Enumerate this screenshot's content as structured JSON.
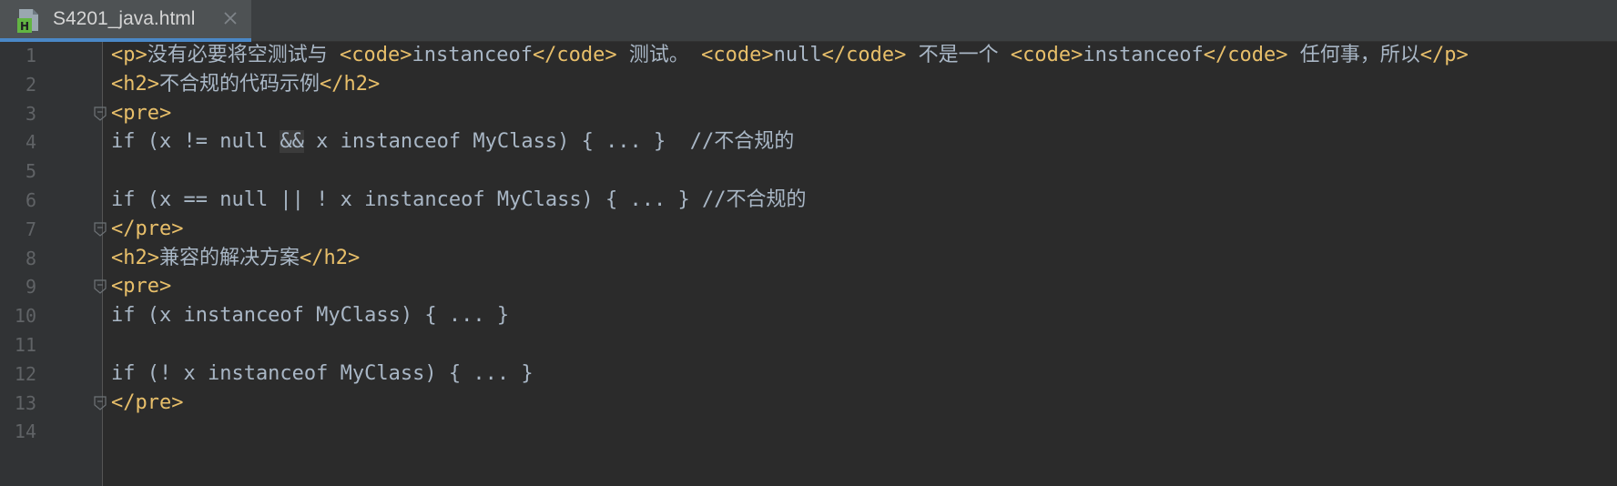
{
  "tab": {
    "label": "S4201_java.html",
    "icon": "html-file-icon"
  },
  "lines": [
    {
      "num": "1",
      "fold": false,
      "segments": [
        {
          "t": "tag",
          "v": "<p>"
        },
        {
          "t": "txt",
          "v": "没有必要将空测试与 "
        },
        {
          "t": "tag",
          "v": "<code>"
        },
        {
          "t": "txt",
          "v": "instanceof"
        },
        {
          "t": "tag",
          "v": "</code>"
        },
        {
          "t": "txt",
          "v": " 测试。 "
        },
        {
          "t": "tag",
          "v": "<code>"
        },
        {
          "t": "txt",
          "v": "null"
        },
        {
          "t": "tag",
          "v": "</code>"
        },
        {
          "t": "txt",
          "v": " 不是一个 "
        },
        {
          "t": "tag",
          "v": "<code>"
        },
        {
          "t": "txt",
          "v": "instanceof"
        },
        {
          "t": "tag",
          "v": "</code>"
        },
        {
          "t": "txt",
          "v": " 任何事，所以"
        },
        {
          "t": "tag",
          "v": "</p>"
        }
      ]
    },
    {
      "num": "2",
      "fold": false,
      "segments": [
        {
          "t": "tag",
          "v": "<h2>"
        },
        {
          "t": "txt",
          "v": "不合规的代码示例"
        },
        {
          "t": "tag",
          "v": "</h2>"
        }
      ]
    },
    {
      "num": "3",
      "fold": true,
      "segments": [
        {
          "t": "tag",
          "v": "<pre>"
        }
      ]
    },
    {
      "num": "4",
      "fold": false,
      "segments": [
        {
          "t": "txt",
          "v": "if (x != null "
        },
        {
          "t": "hl",
          "v": "&&"
        },
        {
          "t": "txt",
          "v": " x instanceof MyClass) { ... }  //不合规的"
        }
      ]
    },
    {
      "num": "5",
      "fold": false,
      "segments": []
    },
    {
      "num": "6",
      "fold": false,
      "segments": [
        {
          "t": "txt",
          "v": "if (x == null || ! x instanceof MyClass) { ... } //不合规的"
        }
      ]
    },
    {
      "num": "7",
      "fold": true,
      "segments": [
        {
          "t": "tag",
          "v": "</pre>"
        }
      ]
    },
    {
      "num": "8",
      "fold": false,
      "segments": [
        {
          "t": "tag",
          "v": "<h2>"
        },
        {
          "t": "txt",
          "v": "兼容的解决方案"
        },
        {
          "t": "tag",
          "v": "</h2>"
        }
      ]
    },
    {
      "num": "9",
      "fold": true,
      "segments": [
        {
          "t": "tag",
          "v": "<pre>"
        }
      ]
    },
    {
      "num": "10",
      "fold": false,
      "segments": [
        {
          "t": "txt",
          "v": "if (x instanceof MyClass) { ... }"
        }
      ]
    },
    {
      "num": "11",
      "fold": false,
      "segments": []
    },
    {
      "num": "12",
      "fold": false,
      "segments": [
        {
          "t": "txt",
          "v": "if (! x instanceof MyClass) { ... }"
        }
      ]
    },
    {
      "num": "13",
      "fold": true,
      "segments": [
        {
          "t": "tag",
          "v": "</pre>"
        }
      ]
    },
    {
      "num": "14",
      "fold": false,
      "segments": []
    }
  ],
  "colors": {
    "background": "#2b2b2b",
    "gutter": "#313335",
    "tag": "#e8bf6a",
    "text": "#a9b7c6",
    "line_number": "#606366",
    "tab_active": "#4e5254",
    "tab_underline": "#4a88c7"
  }
}
